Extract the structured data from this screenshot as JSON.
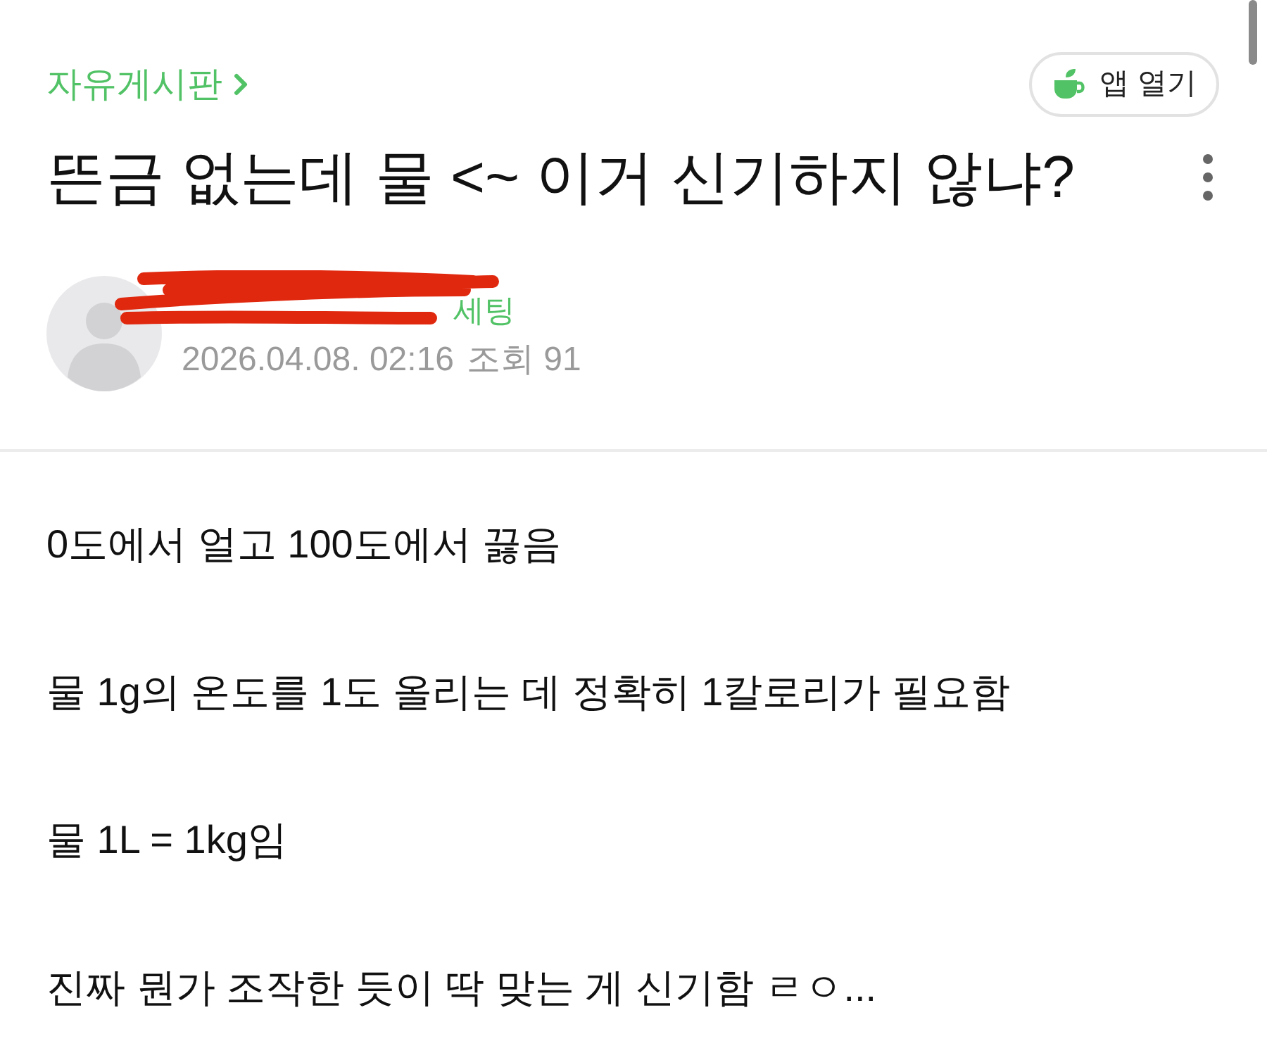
{
  "breadcrumb": {
    "label": "자유게시판"
  },
  "app_button": {
    "label": "앱 열기"
  },
  "title": "뜬금 없는데 물 <~ 이거 신기하지 않냐?",
  "author": {
    "name": "세팅",
    "redacted": true,
    "date": "2026.04.08. 02:16",
    "views": "조회 91"
  },
  "body": {
    "paragraphs": [
      "0도에서 얼고 100도에서 끓음",
      "물 1g의 온도를 1도 올리는 데 정확히 1칼로리가 필요함",
      "물 1L = 1kg임",
      "진짜 뭔가 조작한 듯이 딱 맞는 게 신기함 ㄹㅇ..."
    ]
  }
}
